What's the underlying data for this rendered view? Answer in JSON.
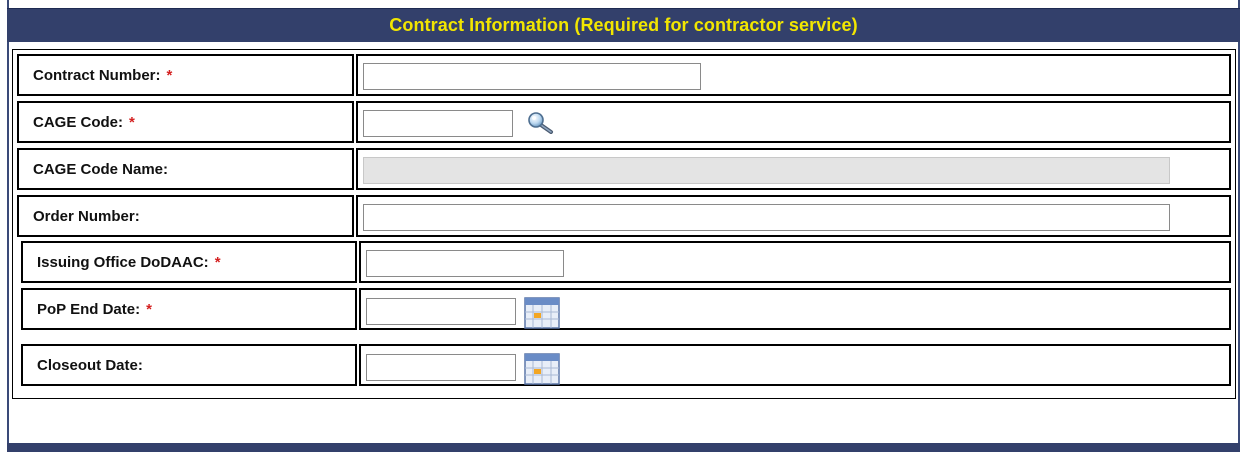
{
  "section": {
    "title": "Contract Information (Required for contractor service)"
  },
  "fields": [
    {
      "label": "Contract Number:",
      "required_mark": "*",
      "value": ""
    },
    {
      "label": "CAGE Code:",
      "required_mark": "*",
      "value": ""
    },
    {
      "label": "CAGE Code Name:",
      "required_mark": "",
      "value": ""
    },
    {
      "label": "Order Number:",
      "required_mark": "",
      "value": ""
    },
    {
      "label": "Issuing Office DoDAAC:",
      "required_mark": "*",
      "value": ""
    },
    {
      "label": "PoP End Date:",
      "required_mark": "*",
      "value": ""
    },
    {
      "label": "Closeout Date:",
      "required_mark": "",
      "value": ""
    }
  ],
  "icons": {
    "lookup": "magnifier-search-icon",
    "date_picker": "calendar-icon"
  },
  "colors": {
    "header_bg": "#33406b",
    "header_text": "#f2e600",
    "required": "#d42020",
    "disabled_input": "#e4e4e4"
  }
}
